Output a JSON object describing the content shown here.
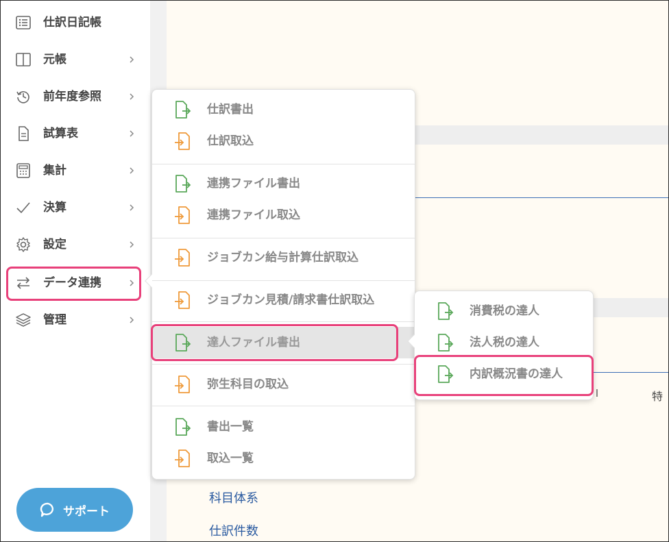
{
  "sidebar": {
    "items": [
      {
        "label": "仕訳日記帳",
        "icon": "list-icon",
        "chevron": false
      },
      {
        "label": "元帳",
        "icon": "book-icon",
        "chevron": true
      },
      {
        "label": "前年度参照",
        "icon": "history-icon",
        "chevron": true
      },
      {
        "label": "試算表",
        "icon": "document-icon",
        "chevron": true
      },
      {
        "label": "集計",
        "icon": "calculator-icon",
        "chevron": true
      },
      {
        "label": "決算",
        "icon": "check-icon",
        "chevron": true
      },
      {
        "label": "設定",
        "icon": "gear-icon",
        "chevron": true
      },
      {
        "label": "データ連携",
        "icon": "swap-arrows-icon",
        "chevron": true,
        "active": true
      },
      {
        "label": "管理",
        "icon": "layers-icon",
        "chevron": true
      }
    ],
    "support_label": "サポート"
  },
  "content": {
    "links": [
      "科目体系",
      "仕訳件数"
    ],
    "fragments": [
      "l",
      "特"
    ]
  },
  "data_menu": {
    "items": [
      {
        "label": "仕訳書出",
        "icon": "export-icon"
      },
      {
        "label": "仕訳取込",
        "icon": "import-icon"
      },
      {
        "label": "連携ファイル書出",
        "icon": "export-icon"
      },
      {
        "label": "連携ファイル取込",
        "icon": "import-icon"
      },
      {
        "label": "ジョブカン給与計算仕訳取込",
        "icon": "import-icon"
      },
      {
        "label": "ジョブカン見積/請求書仕訳取込",
        "icon": "import-icon"
      },
      {
        "label": "達人ファイル書出",
        "icon": "export-icon",
        "selected": true
      },
      {
        "label": "弥生科目の取込",
        "icon": "import-icon"
      },
      {
        "label": "書出一覧",
        "icon": "export-icon"
      },
      {
        "label": "取込一覧",
        "icon": "import-icon"
      }
    ]
  },
  "tatsujin_menu": {
    "items": [
      {
        "label": "消費税の達人",
        "icon": "export-icon"
      },
      {
        "label": "法人税の達人",
        "icon": "export-icon"
      },
      {
        "label": "内訳概況書の達人",
        "icon": "export-icon",
        "highlighted": true
      }
    ]
  },
  "colors": {
    "export": "#5aa85a",
    "import": "#ef9a3a",
    "highlight": "#e8407a",
    "support": "#4da3d9",
    "link": "#2a5aa0"
  }
}
